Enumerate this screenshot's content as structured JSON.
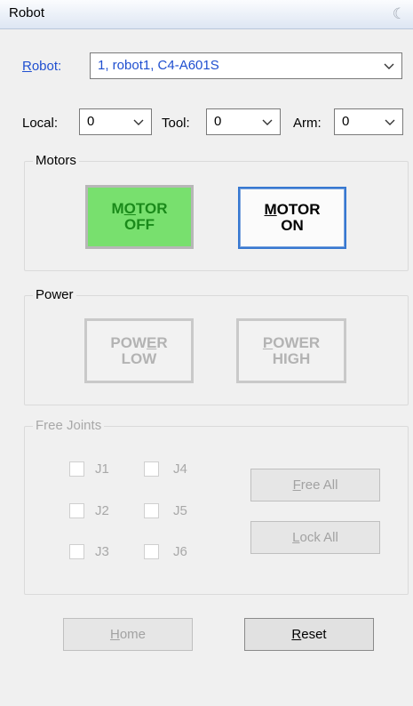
{
  "window": {
    "title": "Robot"
  },
  "robot": {
    "label_prefix": "",
    "label_underline": "R",
    "label_rest": "obot:",
    "selected": "1, robot1, C4-A601S"
  },
  "local": {
    "label": "Local:",
    "value": "0"
  },
  "tool": {
    "label": "Tool:",
    "value": "0"
  },
  "arm": {
    "label": "Arm:",
    "value": "0"
  },
  "motors": {
    "title": "Motors",
    "off_line1_pre": "M",
    "off_line1_u": "O",
    "off_line1_post": "TOR",
    "off_line2": "OFF",
    "on_line1_u": "M",
    "on_line1_post": "OTOR",
    "on_line2": "ON"
  },
  "power": {
    "title": "Power",
    "low_line1_pre": "POW",
    "low_line1_u": "E",
    "low_line1_post": "R",
    "low_line2": "LOW",
    "high_line1_u": "P",
    "high_line1_post": "OWER",
    "high_line2": "HIGH"
  },
  "free_joints": {
    "title": "Free Joints",
    "joints": [
      "J1",
      "J4",
      "J2",
      "J5",
      "J3",
      "J6"
    ],
    "free_all_u": "F",
    "free_all_rest": "ree All",
    "lock_all_u": "L",
    "lock_all_rest": "ock All"
  },
  "bottom": {
    "home_u": "H",
    "home_rest": "ome",
    "reset_u": "R",
    "reset_rest": "eset"
  }
}
